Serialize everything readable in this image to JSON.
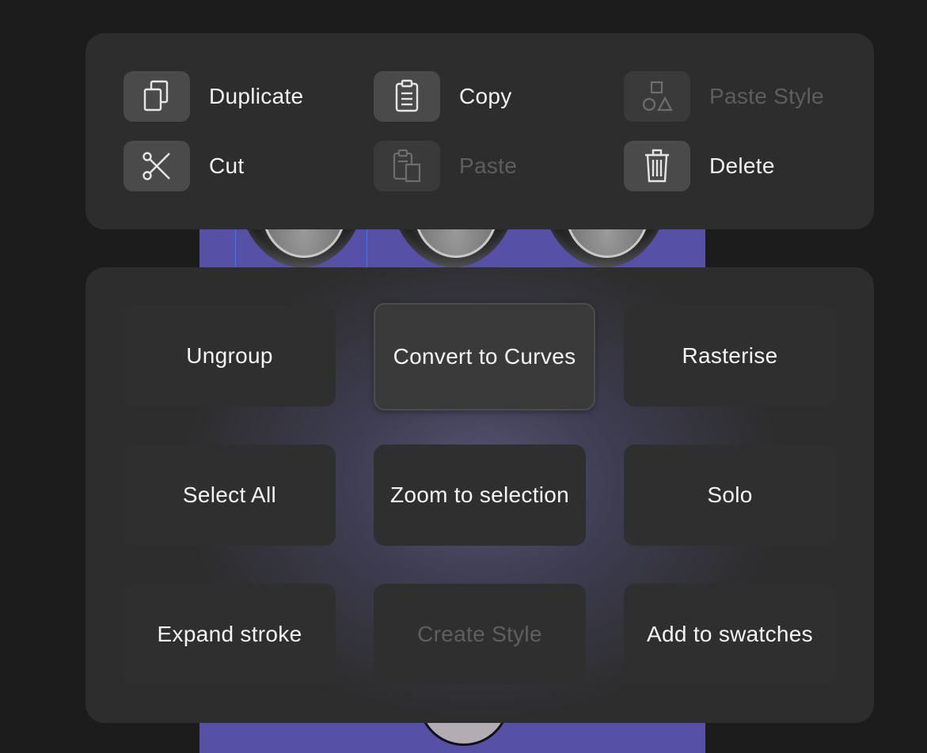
{
  "colors": {
    "background": "#1c1c1c",
    "panel": "#2d2d2d",
    "icon_tile": "#4a4a4a",
    "canvas": "#5650a6",
    "disabled_text": "#5e5e5e"
  },
  "edit_menu": {
    "items": [
      {
        "label": "Duplicate",
        "icon": "duplicate-icon",
        "enabled": true
      },
      {
        "label": "Copy",
        "icon": "clipboard-icon",
        "enabled": true
      },
      {
        "label": "Paste Style",
        "icon": "shapes-icon",
        "enabled": false
      },
      {
        "label": "Cut",
        "icon": "scissors-icon",
        "enabled": true
      },
      {
        "label": "Paste",
        "icon": "paste-icon",
        "enabled": false
      },
      {
        "label": "Delete",
        "icon": "trash-icon",
        "enabled": true
      }
    ]
  },
  "action_grid": {
    "items": [
      {
        "label": "Ungroup",
        "enabled": true
      },
      {
        "label": "Convert to Curves",
        "enabled": true,
        "highlighted": true
      },
      {
        "label": "Rasterise",
        "enabled": true
      },
      {
        "label": "Select All",
        "enabled": true
      },
      {
        "label": "Zoom to selection",
        "enabled": true
      },
      {
        "label": "Solo",
        "enabled": true
      },
      {
        "label": "Expand stroke",
        "enabled": true
      },
      {
        "label": "Create Style",
        "enabled": false
      },
      {
        "label": "Add to swatches",
        "enabled": true
      }
    ]
  }
}
